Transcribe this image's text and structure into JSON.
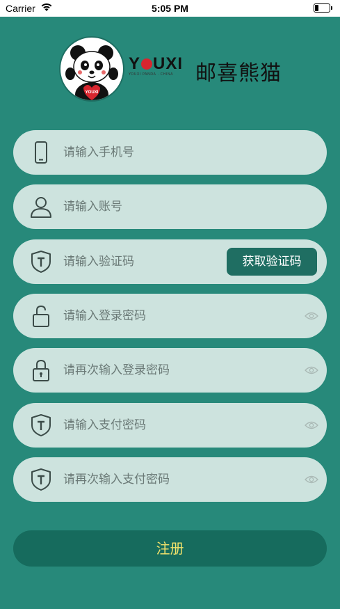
{
  "status_bar": {
    "carrier": "Carrier",
    "time": "5:05 PM"
  },
  "logo": {
    "brand_en_y": "Y",
    "brand_en_rest": "UXI",
    "brand_sub": "YOUXI PANDA · CHINA",
    "brand_cn": "邮喜熊猫",
    "badge": "YOUXI"
  },
  "form": {
    "phone_placeholder": "请输入手机号",
    "account_placeholder": "请输入账号",
    "code_placeholder": "请输入验证码",
    "get_code_label": "获取验证码",
    "login_password_placeholder": "请输入登录密码",
    "login_password_confirm_placeholder": "请再次输入登录密码",
    "pay_password_placeholder": "请输入支付密码",
    "pay_password_confirm_placeholder": "请再次输入支付密码",
    "register_label": "注册"
  },
  "colors": {
    "background": "#27897a",
    "field": "#cde3de",
    "button": "#1f6e62",
    "register_text": "#f2e26b"
  },
  "icons": [
    "wifi-icon",
    "battery-icon",
    "phone-icon",
    "user-icon",
    "shield-icon",
    "lock-open-icon",
    "lock-icon",
    "eye-icon"
  ]
}
